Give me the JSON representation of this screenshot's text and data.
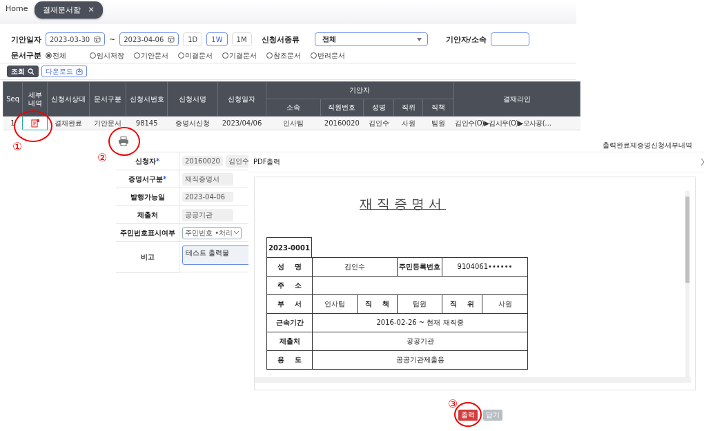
{
  "tabs": [
    {
      "label": "Home",
      "selected": false
    },
    {
      "label": "결재문서함",
      "selected": true,
      "close": "×"
    }
  ],
  "filters": {
    "date_label": "기안일자",
    "date_from": "2023-03-30",
    "date_sep": "~",
    "date_to": "2023-04-06",
    "ranges": [
      {
        "label": "1D",
        "selected": false
      },
      {
        "label": "1W",
        "selected": true
      },
      {
        "label": "1M",
        "selected": false
      }
    ],
    "type_label": "신청서종류",
    "type_value": "전체",
    "drafter_label": "기안자/소속",
    "doc_label": "문서구분",
    "doc_options": [
      {
        "label": "전체",
        "selected": true
      },
      {
        "label": "임시저장",
        "selected": false
      },
      {
        "label": "기안문서",
        "selected": false
      },
      {
        "label": "미결문서",
        "selected": false
      },
      {
        "label": "기결문서",
        "selected": false
      },
      {
        "label": "참조문서",
        "selected": false
      },
      {
        "label": "반려문서",
        "selected": false
      }
    ]
  },
  "actions": [
    {
      "label": "조회",
      "kind": "search"
    },
    {
      "label": "다운로드",
      "kind": "download"
    }
  ],
  "table": {
    "columns": [
      {
        "label": "Seq"
      },
      {
        "label": "세부\n내역"
      },
      {
        "label": "신청서상태"
      },
      {
        "label": "문서구분"
      },
      {
        "label": "신청서번호"
      },
      {
        "label": "신청서명"
      },
      {
        "label": "신청일자"
      },
      {
        "label": "기안자",
        "children": [
          {
            "label": "소속"
          },
          {
            "label": "직원번호"
          },
          {
            "label": "성명"
          },
          {
            "label": "직위"
          },
          {
            "label": "직책"
          }
        ]
      },
      {
        "label": "결재라인"
      }
    ],
    "rows": [
      {
        "seq": "1",
        "values": [
          "결재완료",
          "기안문서",
          "98145",
          "증명서신청",
          "2023/04/06",
          "인사팀",
          "20160020",
          "김인수",
          "사원",
          "팀원",
          "김인수(O)▶김시우(O)▶오사공(…"
        ]
      }
    ]
  },
  "detail_panel": {
    "title": "출력완료제증명신청세부내역",
    "fields": [
      {
        "label": "신청자",
        "marker": "*",
        "kind": "pair",
        "values": [
          "20160020",
          "김인수"
        ]
      },
      {
        "label": "증명서구분",
        "marker": "*",
        "kind": "text",
        "value": "재직증명서"
      },
      {
        "label": "발행가능일",
        "kind": "text",
        "value": "2023-04-06"
      },
      {
        "label": "제출처",
        "kind": "text",
        "value": "공공기관"
      },
      {
        "label": "주민번호표시여부",
        "kind": "select",
        "value": "주민번호 •처리"
      },
      {
        "label": "비고",
        "kind": "textarea",
        "value": "테스트 출력물"
      }
    ]
  },
  "pdf_dialog": {
    "title": "PDF출력",
    "document": {
      "title": "재직증명서",
      "number": "2023-0001",
      "rows": [
        {
          "cells": [
            {
              "text": "성 명",
              "head": true
            },
            {
              "text": "김인수",
              "colspan": 2
            },
            {
              "text": "주민등록번호",
              "head": true
            },
            {
              "text": "9104061••••••",
              "colspan": 2
            }
          ]
        },
        {
          "cells": [
            {
              "text": "주 소",
              "head": true
            }
          ]
        },
        {
          "cells": [
            {
              "text": "부 서",
              "head": true
            },
            {
              "text": "인사팀"
            },
            {
              "text": "직 책",
              "head": true
            },
            {
              "text": "팀원"
            },
            {
              "text": "직 위",
              "head": true
            },
            {
              "text": "사원"
            }
          ]
        },
        {
          "cells": [
            {
              "text": "근속기간",
              "head": true
            },
            {
              "text": "2016-02-26 ~ 현재 재직중",
              "colspan": 5
            }
          ]
        },
        {
          "cells": [
            {
              "text": "제출처",
              "head": true
            },
            {
              "text": "공공기관",
              "colspan": 5
            }
          ]
        },
        {
          "cells": [
            {
              "text": "용 도",
              "head": true
            },
            {
              "text": "공공기관제출용",
              "colspan": 5
            }
          ]
        }
      ]
    },
    "buttons": [
      {
        "label": "출력",
        "kind": "print"
      },
      {
        "label": "닫기",
        "kind": "close"
      }
    ]
  },
  "annotations": [
    {
      "number": "①"
    },
    {
      "number": "②"
    },
    {
      "number": "③"
    }
  ]
}
